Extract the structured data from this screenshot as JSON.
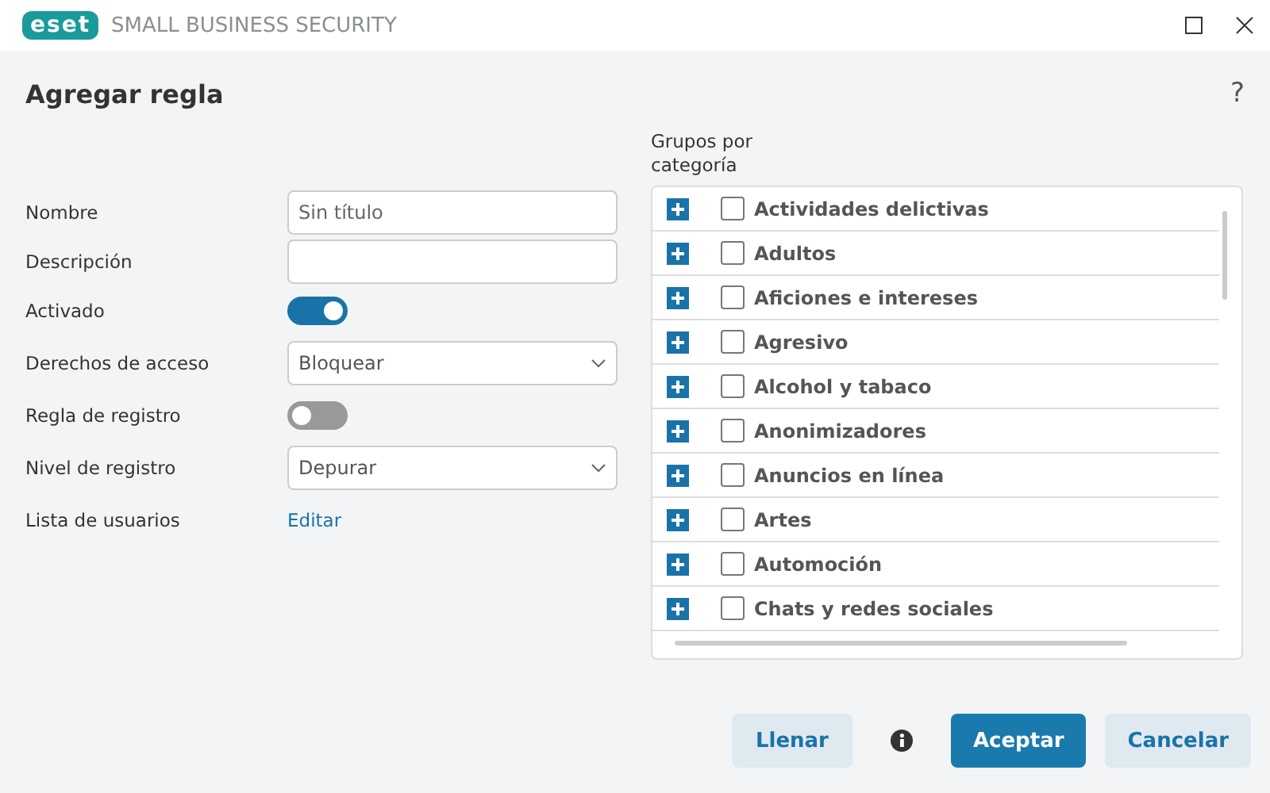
{
  "window": {
    "logo": "eset",
    "title": "SMALL BUSINESS SECURITY"
  },
  "dialog": {
    "title": "Agregar regla",
    "help": "?"
  },
  "form": [
    {
      "kind": "text",
      "label": "Nombre",
      "placeholder": "Sin título"
    },
    {
      "kind": "text",
      "label": "Descripción"
    },
    {
      "kind": "toggle",
      "label": "Activado",
      "on": true
    },
    {
      "kind": "select",
      "label": "Derechos de acceso",
      "value": "Bloquear"
    },
    {
      "kind": "toggle",
      "label": "Regla de registro",
      "on": false
    },
    {
      "kind": "select",
      "label": "Nivel de registro",
      "value": "Depurar"
    },
    {
      "kind": "link",
      "label": "Lista de usuarios",
      "value": "Editar"
    }
  ],
  "groups": {
    "label": "Grupos por categoría",
    "items": [
      {
        "name": "Actividades delictivas",
        "checked": false
      },
      {
        "name": "Adultos",
        "checked": false
      },
      {
        "name": "Aficiones e intereses",
        "checked": false
      },
      {
        "name": "Agresivo",
        "checked": false
      },
      {
        "name": "Alcohol y tabaco",
        "checked": false
      },
      {
        "name": "Anonimizadores",
        "checked": false
      },
      {
        "name": "Anuncios en línea",
        "checked": false
      },
      {
        "name": "Artes",
        "checked": false
      },
      {
        "name": "Automoción",
        "checked": false
      },
      {
        "name": "Chats y redes sociales",
        "checked": false
      }
    ]
  },
  "buttons": [
    {
      "kind": "secondary",
      "label": "Llenar"
    },
    {
      "kind": "info"
    },
    {
      "kind": "primary",
      "label": "Aceptar"
    },
    {
      "kind": "secondary",
      "label": "Cancelar"
    }
  ]
}
